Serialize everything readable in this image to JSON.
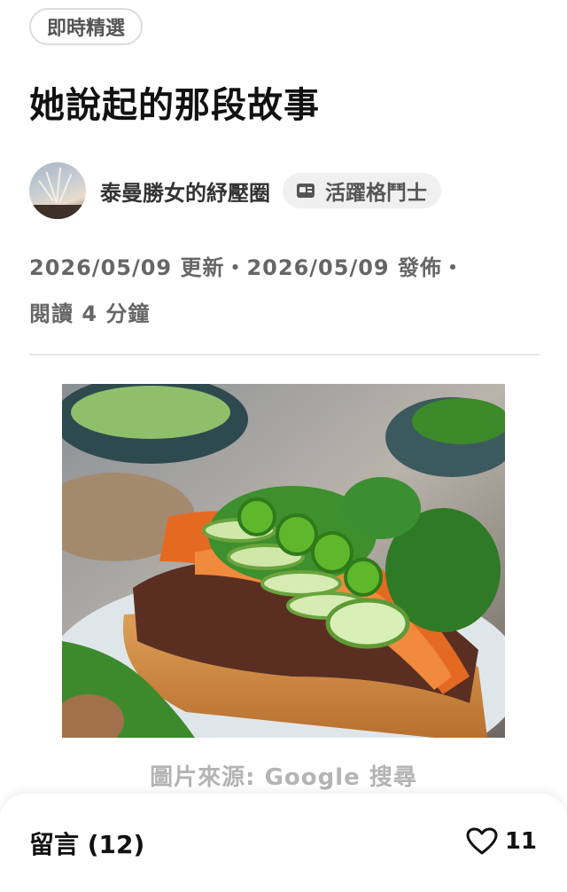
{
  "category_tag": "即時精選",
  "title": "她說起的那段故事",
  "author": {
    "name": "泰曼勝女的紓壓圈",
    "badge": "活躍格鬥士",
    "badge_icon": "id-card-icon",
    "avatar": "reed-photo-avatar"
  },
  "meta": {
    "line1": "2026/05/09 更新・2026/05/09 發佈・",
    "line2": "閱讀 4 分鐘"
  },
  "image": {
    "description_icon": "banh-mi-sandwich-photo",
    "caption": "圖片來源: Google 搜尋"
  },
  "comments": {
    "label": "留言 (12)",
    "likes": "11",
    "like_icon": "heart-outline-icon"
  }
}
